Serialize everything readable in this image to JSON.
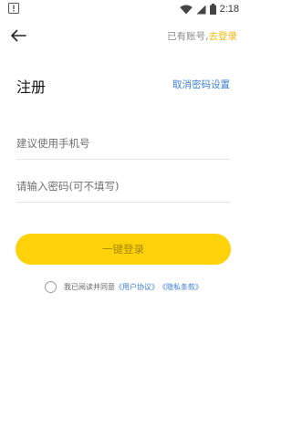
{
  "status_bar": {
    "time": "2:18",
    "icons": [
      "alert-icon",
      "wifi-icon",
      "signal-icon",
      "battery-icon"
    ]
  },
  "nav": {
    "back_icon": "arrow-left-icon",
    "has_account_text": "已有账号,",
    "login_link": "去登录"
  },
  "header": {
    "title": "注册",
    "cancel_password_link": "取消密码设置"
  },
  "form": {
    "phone_placeholder": "建议使用手机号",
    "password_placeholder": "请输入密码(可不填写)",
    "submit_label": "一键登录"
  },
  "agreement": {
    "text": "我已阅读并同意",
    "user_agreement": "《用户协议》",
    "privacy_policy": "《隐私条款》",
    "checked": false
  },
  "colors": {
    "accent_yellow": "#fdd20a",
    "login_link": "#f2b80a",
    "link_blue": "#3d7fd9"
  }
}
